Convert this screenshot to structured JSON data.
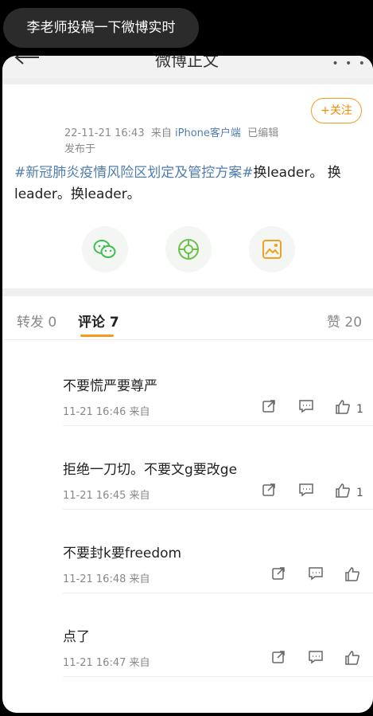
{
  "toast": "李老师投稿一下微博实时",
  "header": {
    "title": "微博正文",
    "more": "• • •"
  },
  "post": {
    "follow_label": "+关注",
    "time": "22-11-21 16:43",
    "from_label": "来自",
    "source": "iPhone客户端",
    "edited": "已编辑",
    "published": "发布于",
    "hashtag": "#新冠肺炎疫情风险区划定及管控方案#",
    "body_line1_rest": "换leader。 换",
    "body_line2": "leader。换leader。"
  },
  "share": {
    "icons": [
      "wechat-icon",
      "moments-icon",
      "save-image-icon"
    ]
  },
  "tabs": {
    "repost": "转发 0",
    "comments": "评论 7",
    "likes": "赞 20"
  },
  "comments": [
    {
      "text": "不要慌严要尊严",
      "time": "11-21 16:46 来自",
      "likes": "1"
    },
    {
      "text": "拒绝一刀切。不要文g要改ge",
      "time": "11-21 16:45 来自",
      "likes": "1"
    },
    {
      "text": "不要封k要freedom",
      "time": "11-21 16:48 来自",
      "likes": ""
    },
    {
      "text": "点了",
      "time": "11-21 16:47 来自",
      "likes": ""
    }
  ],
  "colors": {
    "accent": "#f79a1c",
    "link": "#507daf",
    "toast_bg": "#2b2b2b"
  }
}
